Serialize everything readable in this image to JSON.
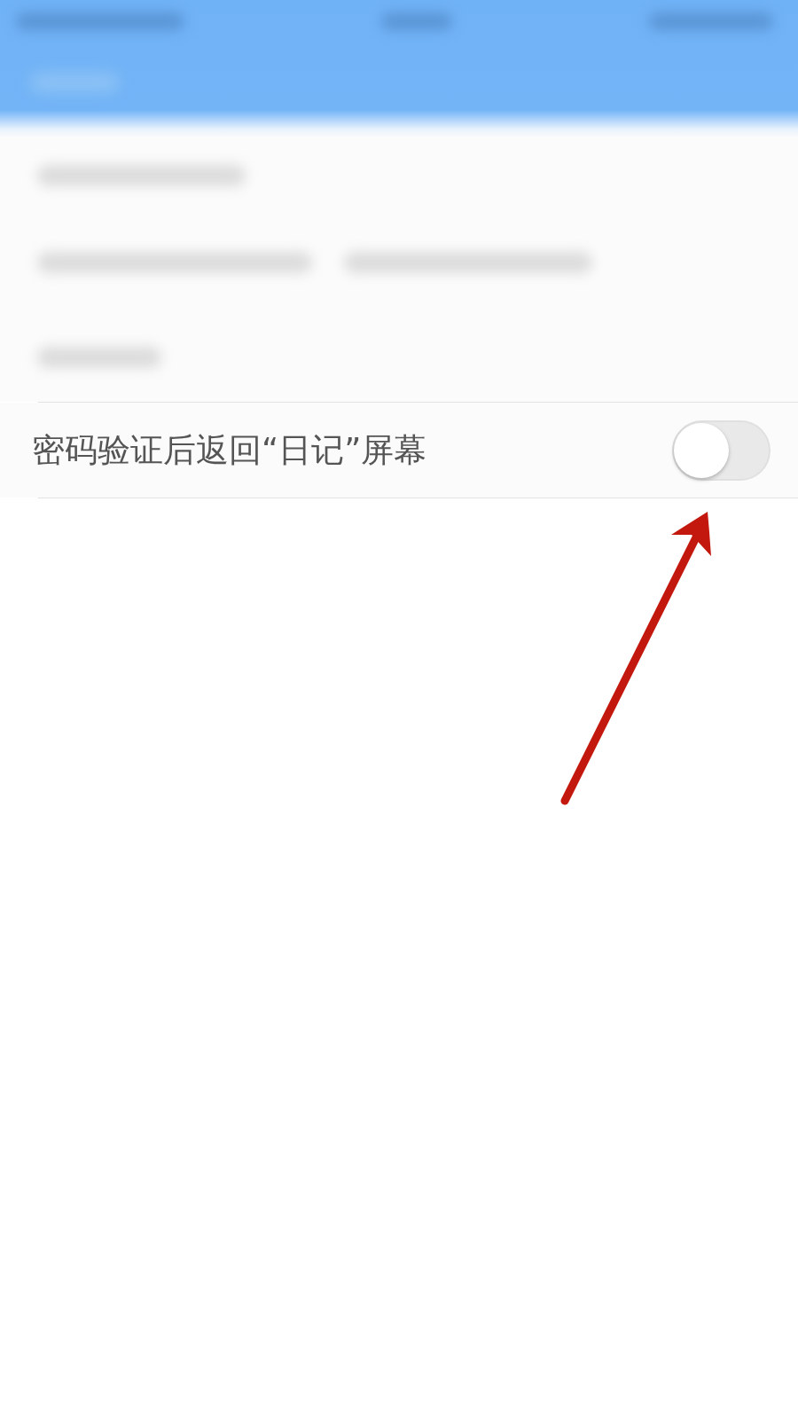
{
  "settings": [
    {
      "kind": "toggle",
      "label": "密码验证后返回“日记”屏幕",
      "on": false
    }
  ]
}
